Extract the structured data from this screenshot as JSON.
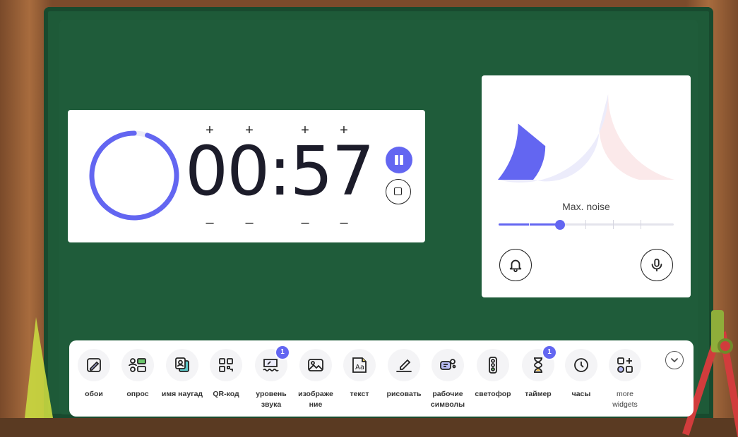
{
  "timer": {
    "display": "00:57",
    "plus_label": "+",
    "minus_label": "–",
    "remaining_fraction": 0.95,
    "accent": "#6366f1"
  },
  "noise": {
    "label": "Max. noise",
    "level_fraction": 0.35,
    "gauge_fraction": 0.22,
    "colors": {
      "low": "#6366f1",
      "mid": "#ececfb",
      "high": "#fbe9ea"
    }
  },
  "toolbar": {
    "tools": [
      {
        "name": "wallpaper",
        "label": "обои",
        "icon": "wallpaper-icon"
      },
      {
        "name": "poll",
        "label": "опрос",
        "icon": "poll-icon"
      },
      {
        "name": "random-name",
        "label": "имя наугад",
        "icon": "random-name-icon"
      },
      {
        "name": "qr-code",
        "label": "QR-код",
        "icon": "qr-code-icon"
      },
      {
        "name": "sound-level",
        "label": "уровень звука",
        "icon": "sound-level-icon",
        "badge": "1"
      },
      {
        "name": "image",
        "label": "изображе ние",
        "icon": "image-icon"
      },
      {
        "name": "text",
        "label": "текст",
        "icon": "text-icon"
      },
      {
        "name": "draw",
        "label": "рисовать",
        "icon": "draw-icon"
      },
      {
        "name": "work-symbols",
        "label": "рабочие символы",
        "icon": "work-symbols-icon"
      },
      {
        "name": "traffic-light",
        "label": "светофор",
        "icon": "traffic-light-icon"
      },
      {
        "name": "timer",
        "label": "таймер",
        "icon": "hourglass-icon",
        "badge": "1"
      },
      {
        "name": "clock",
        "label": "часы",
        "icon": "clock-icon"
      },
      {
        "name": "more-widgets",
        "label": "more widgets",
        "icon": "more-widgets-icon"
      }
    ]
  }
}
